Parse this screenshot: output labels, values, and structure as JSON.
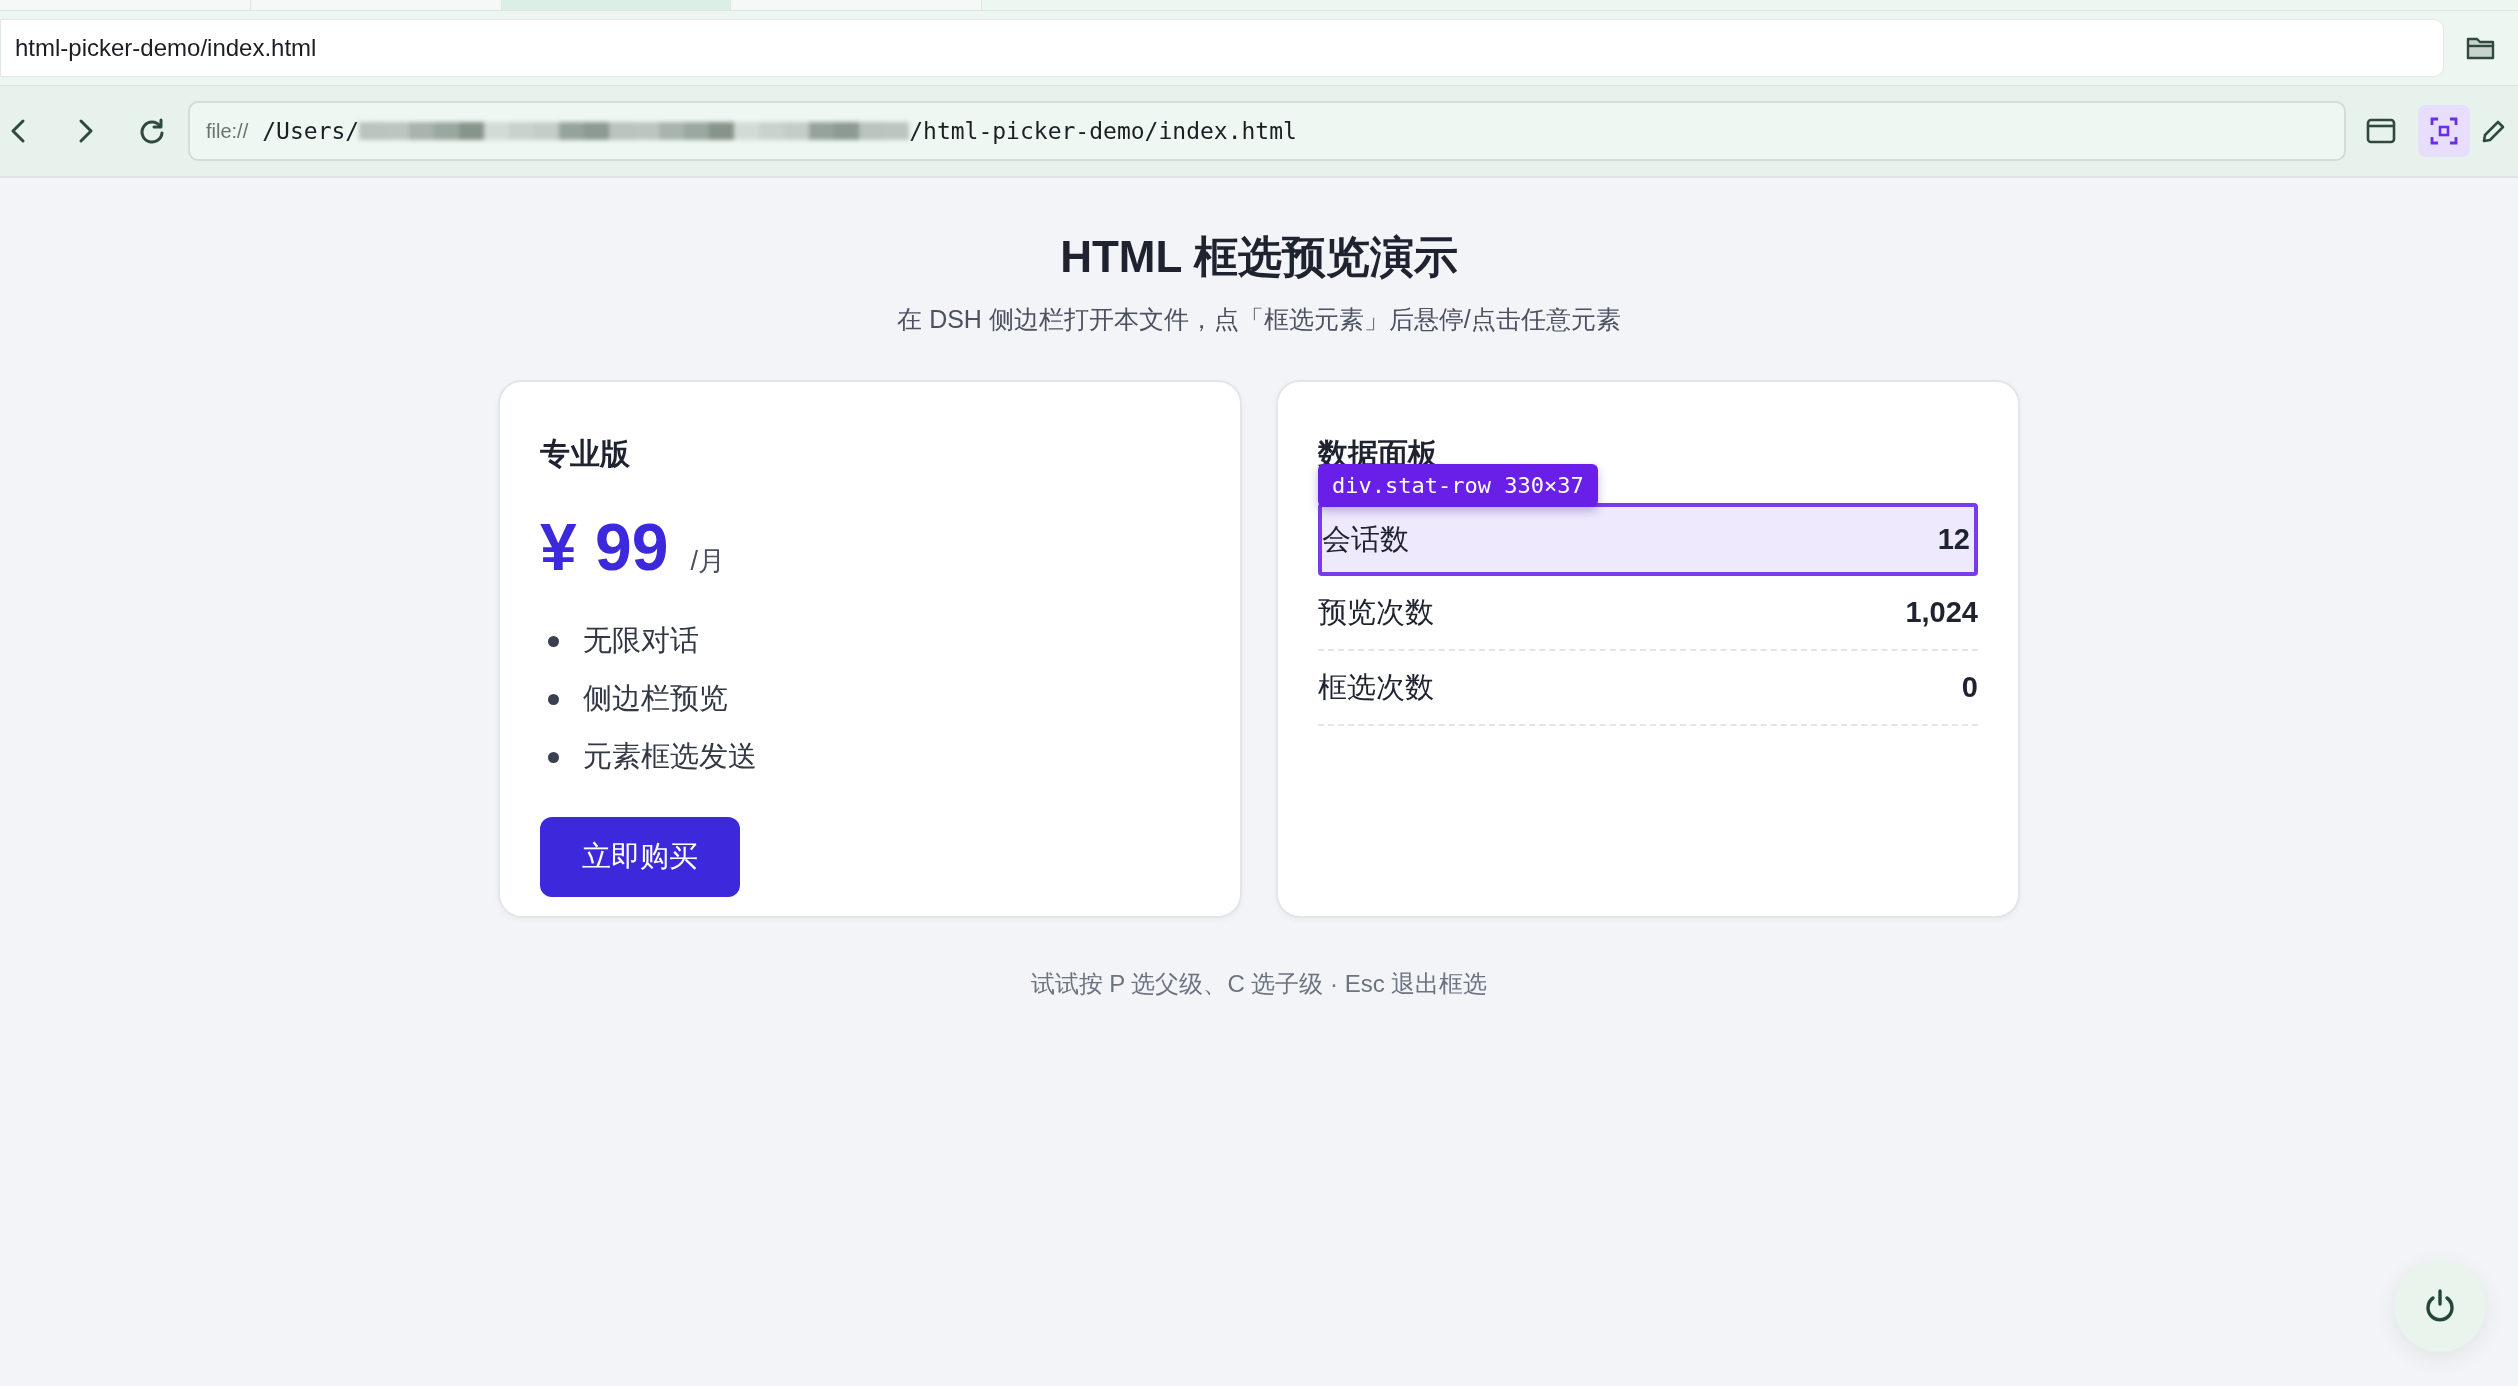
{
  "tabs": [
    {
      "selected": false
    },
    {
      "selected": false
    },
    {
      "selected": true
    },
    {
      "selected": false
    }
  ],
  "path_bar": {
    "value": "html-picker-demo/index.html"
  },
  "address_bar": {
    "scheme": "file://",
    "path_start": "/Users/",
    "path_end": "/html-picker-demo/index.html"
  },
  "toolbar": {
    "picker_active": true
  },
  "page": {
    "title": "HTML 框选预览演示",
    "subtitle": "在 DSH 侧边栏打开本文件，点「框选元素」后悬停/点击任意元素",
    "pricing_card": {
      "heading": "专业版",
      "price": "¥ 99",
      "period": "/月",
      "features": [
        "无限对话",
        "侧边栏预览",
        "元素框选发送"
      ],
      "button": "立即购买"
    },
    "stats_card": {
      "heading": "数据面板",
      "rows": [
        {
          "label": "会话数",
          "value": "12",
          "highlighted": true
        },
        {
          "label": "预览次数",
          "value": "1,024",
          "highlighted": false
        },
        {
          "label": "框选次数",
          "value": "0",
          "highlighted": false
        }
      ]
    },
    "picker_tooltip": "div.stat-row 330×37",
    "footer": "试试按 P 选父级、C 选子级 · Esc 退出框选"
  }
}
